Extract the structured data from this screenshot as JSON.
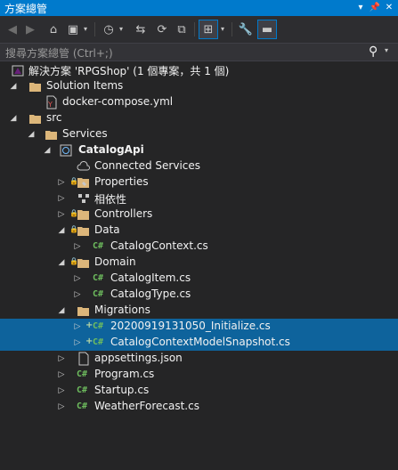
{
  "window": {
    "title": "方案總管"
  },
  "search": {
    "placeholder": "搜尋方案總管 (Ctrl+;)"
  },
  "tree": {
    "solution": "解決方案 'RPGShop' (1 個專案，共 1 個)",
    "solution_items": "Solution Items",
    "docker_compose": "docker-compose.yml",
    "src": "src",
    "services": "Services",
    "catalog_api": "CatalogApi",
    "connected_services": "Connected Services",
    "properties": "Properties",
    "dependencies": "相依性",
    "controllers": "Controllers",
    "data": "Data",
    "catalog_context": "CatalogContext.cs",
    "domain": "Domain",
    "catalog_item": "CatalogItem.cs",
    "catalog_type": "CatalogType.cs",
    "migrations": "Migrations",
    "migration_initialize": "20200919131050_Initialize.cs",
    "migration_snapshot": "CatalogContextModelSnapshot.cs",
    "appsettings": "appsettings.json",
    "program": "Program.cs",
    "startup": "Startup.cs",
    "weather_forecast": "WeatherForecast.cs"
  },
  "colors": {
    "accent": "#007acc",
    "selection": "#0e639c",
    "folder": "#dcb67a",
    "csharp": "#6ebd5e"
  }
}
